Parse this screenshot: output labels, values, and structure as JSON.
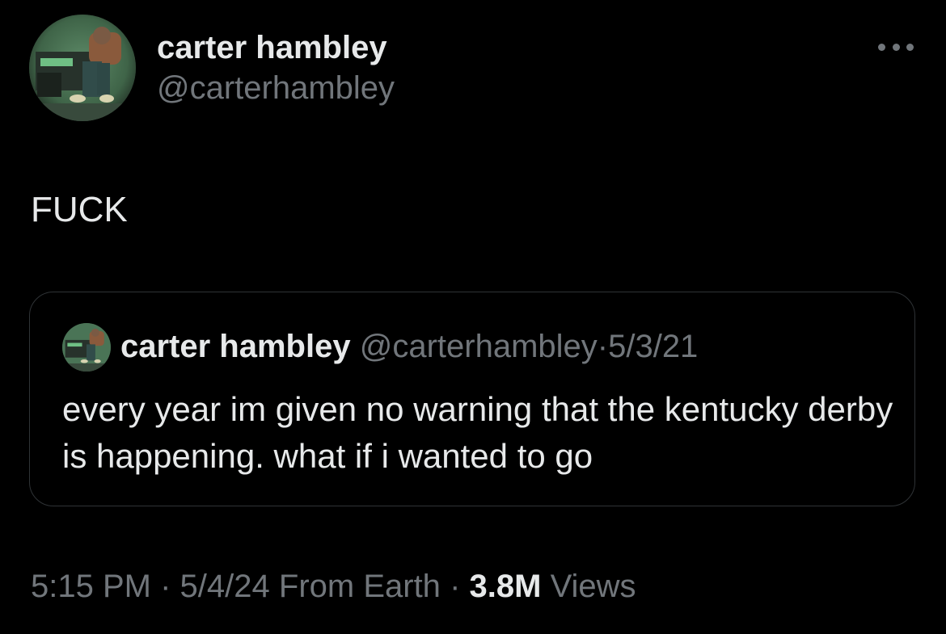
{
  "author": {
    "display_name": "carter hambley",
    "handle": "@carterhambley",
    "avatar_icon": "profile-photo"
  },
  "more_icon": "ellipsis-icon",
  "tweet": {
    "text": "FUCK"
  },
  "quoted_tweet": {
    "display_name": "carter hambley",
    "handle": "@carterhambley",
    "separator": "·",
    "date": "5/3/21",
    "text": "every year im given no warning that the kentucky derby is happening. what if i wanted to go"
  },
  "meta": {
    "time": "5:15 PM",
    "separator1": "·",
    "date": "5/4/24",
    "source": "From Earth",
    "separator2": "·",
    "views_count": "3.8M",
    "views_label": "Views"
  },
  "colors": {
    "background": "#000000",
    "primary_text": "#e7e9ea",
    "secondary_text": "#71767b",
    "border": "#2f3336"
  }
}
